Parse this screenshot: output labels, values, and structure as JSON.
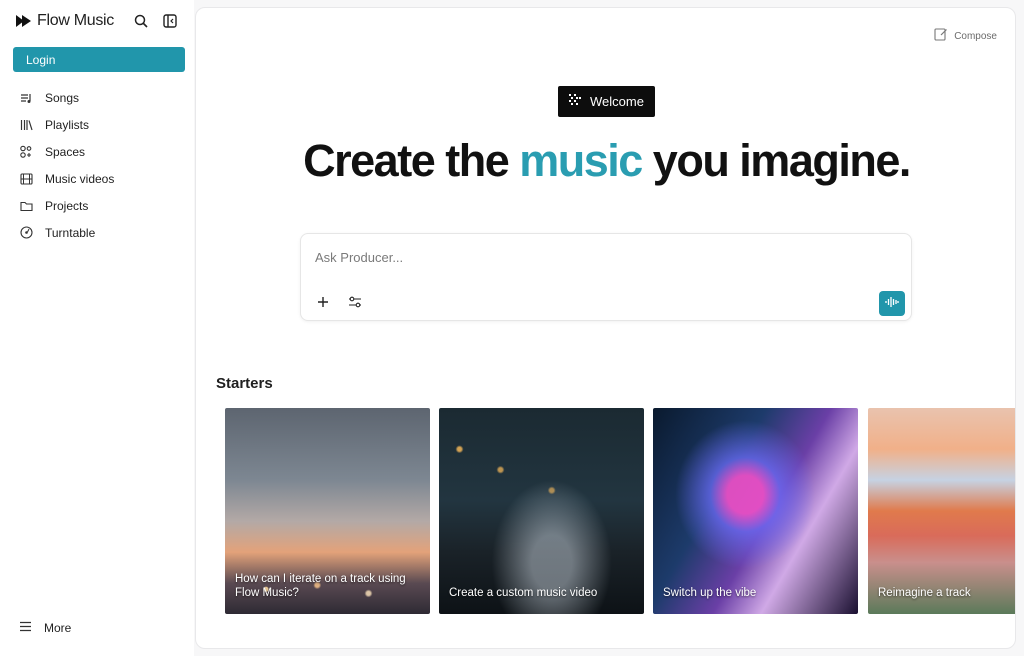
{
  "app": {
    "name": "Flow Music"
  },
  "sidebar": {
    "login_label": "Login",
    "items": [
      {
        "label": "Songs",
        "icon": "songs-icon"
      },
      {
        "label": "Playlists",
        "icon": "library-icon"
      },
      {
        "label": "Spaces",
        "icon": "spaces-icon"
      },
      {
        "label": "Music videos",
        "icon": "film-icon"
      },
      {
        "label": "Projects",
        "icon": "folder-icon"
      },
      {
        "label": "Turntable",
        "icon": "turntable-icon"
      }
    ],
    "more_label": "More"
  },
  "main": {
    "compose_label": "Compose",
    "welcome_label": "Welcome",
    "headline": {
      "before": "Create the ",
      "accent": "music",
      "after": " you imagine."
    },
    "ask": {
      "placeholder": "Ask Producer..."
    },
    "starters_title": "Starters",
    "starters": [
      {
        "caption": "How can I iterate on a track using Flow Music?"
      },
      {
        "caption": "Create a custom music video"
      },
      {
        "caption": "Switch up the vibe"
      },
      {
        "caption": "Reimagine a track"
      }
    ]
  },
  "colors": {
    "accent": "#2196ab",
    "headline_accent": "#2a9db1",
    "welcome_bg": "#0d0d0d"
  }
}
